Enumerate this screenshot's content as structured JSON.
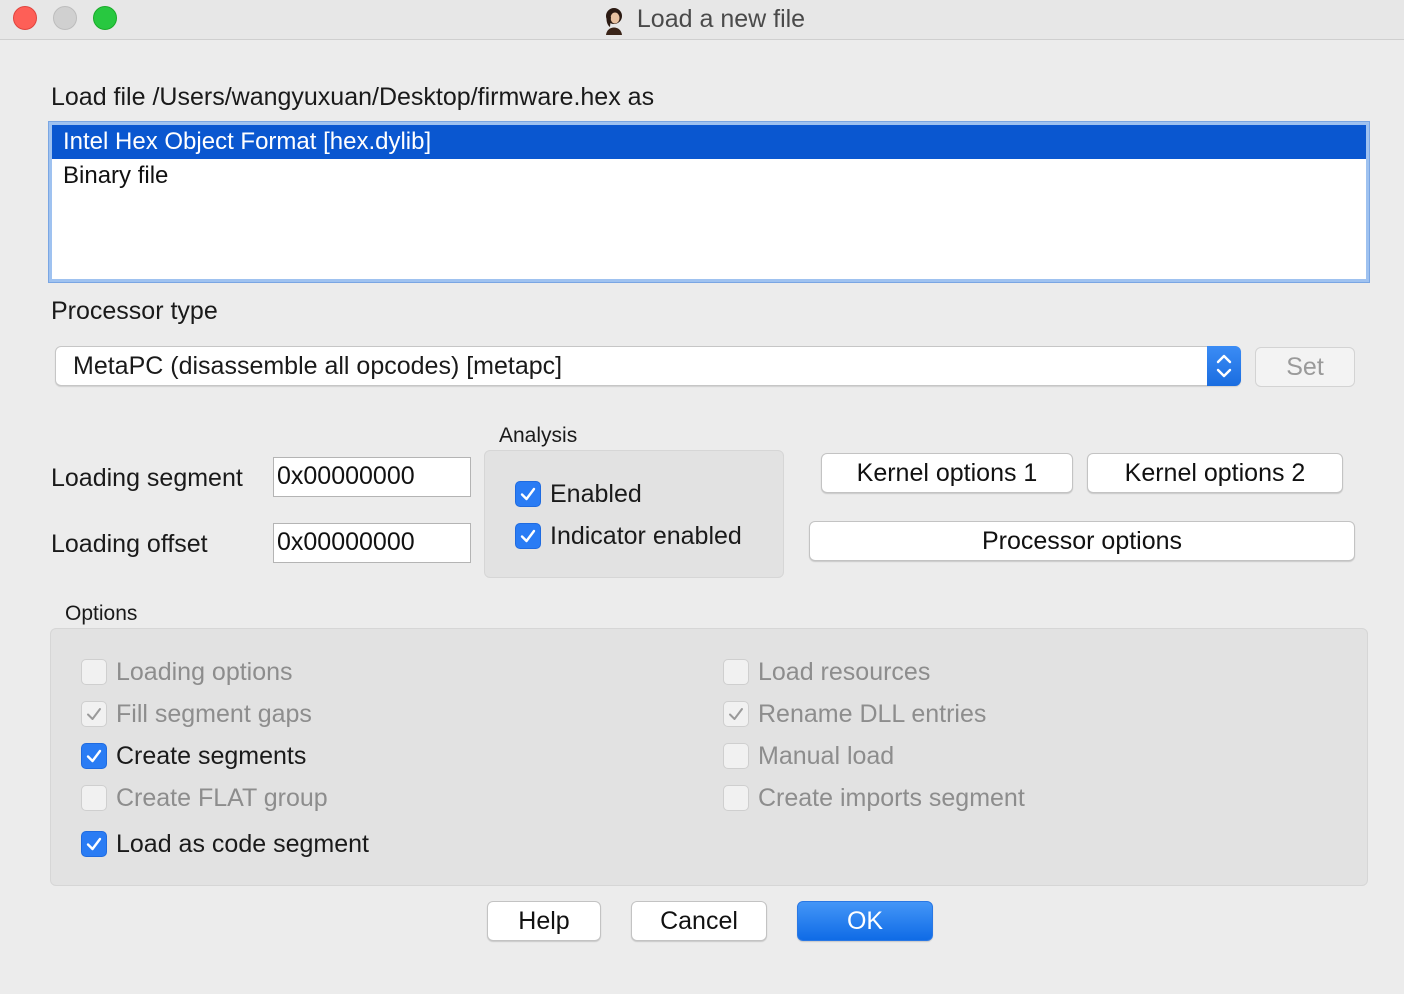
{
  "window": {
    "title": "Load a new file"
  },
  "load_file_label": "Load file /Users/wangyuxuan/Desktop/firmware.hex as",
  "formats": [
    {
      "label": "Intel Hex Object Format [hex.dylib]",
      "selected": true
    },
    {
      "label": "Binary file",
      "selected": false
    }
  ],
  "processor": {
    "label": "Processor type",
    "value": "MetaPC (disassemble all opcodes) [metapc]",
    "set_label": "Set"
  },
  "loading": {
    "segment_label": "Loading segment",
    "segment_value": "0x00000000",
    "offset_label": "Loading offset",
    "offset_value": "0x00000000"
  },
  "analysis": {
    "title": "Analysis",
    "enabled_label": "Enabled",
    "indicator_label": "Indicator enabled"
  },
  "buttons": {
    "kernel1": "Kernel options 1",
    "kernel2": "Kernel options 2",
    "processor_options": "Processor options",
    "help": "Help",
    "cancel": "Cancel",
    "ok": "OK"
  },
  "options": {
    "title": "Options",
    "loading_options": "Loading options",
    "fill_segment_gaps": "Fill segment gaps",
    "create_segments": "Create segments",
    "create_flat_group": "Create FLAT group",
    "load_as_code_segment": "Load as code segment",
    "load_resources": "Load resources",
    "rename_dll_entries": "Rename DLL entries",
    "manual_load": "Manual load",
    "create_imports_segment": "Create imports segment"
  },
  "colors": {
    "accent": "#2a7cf4",
    "selection": "#0a57d0"
  }
}
